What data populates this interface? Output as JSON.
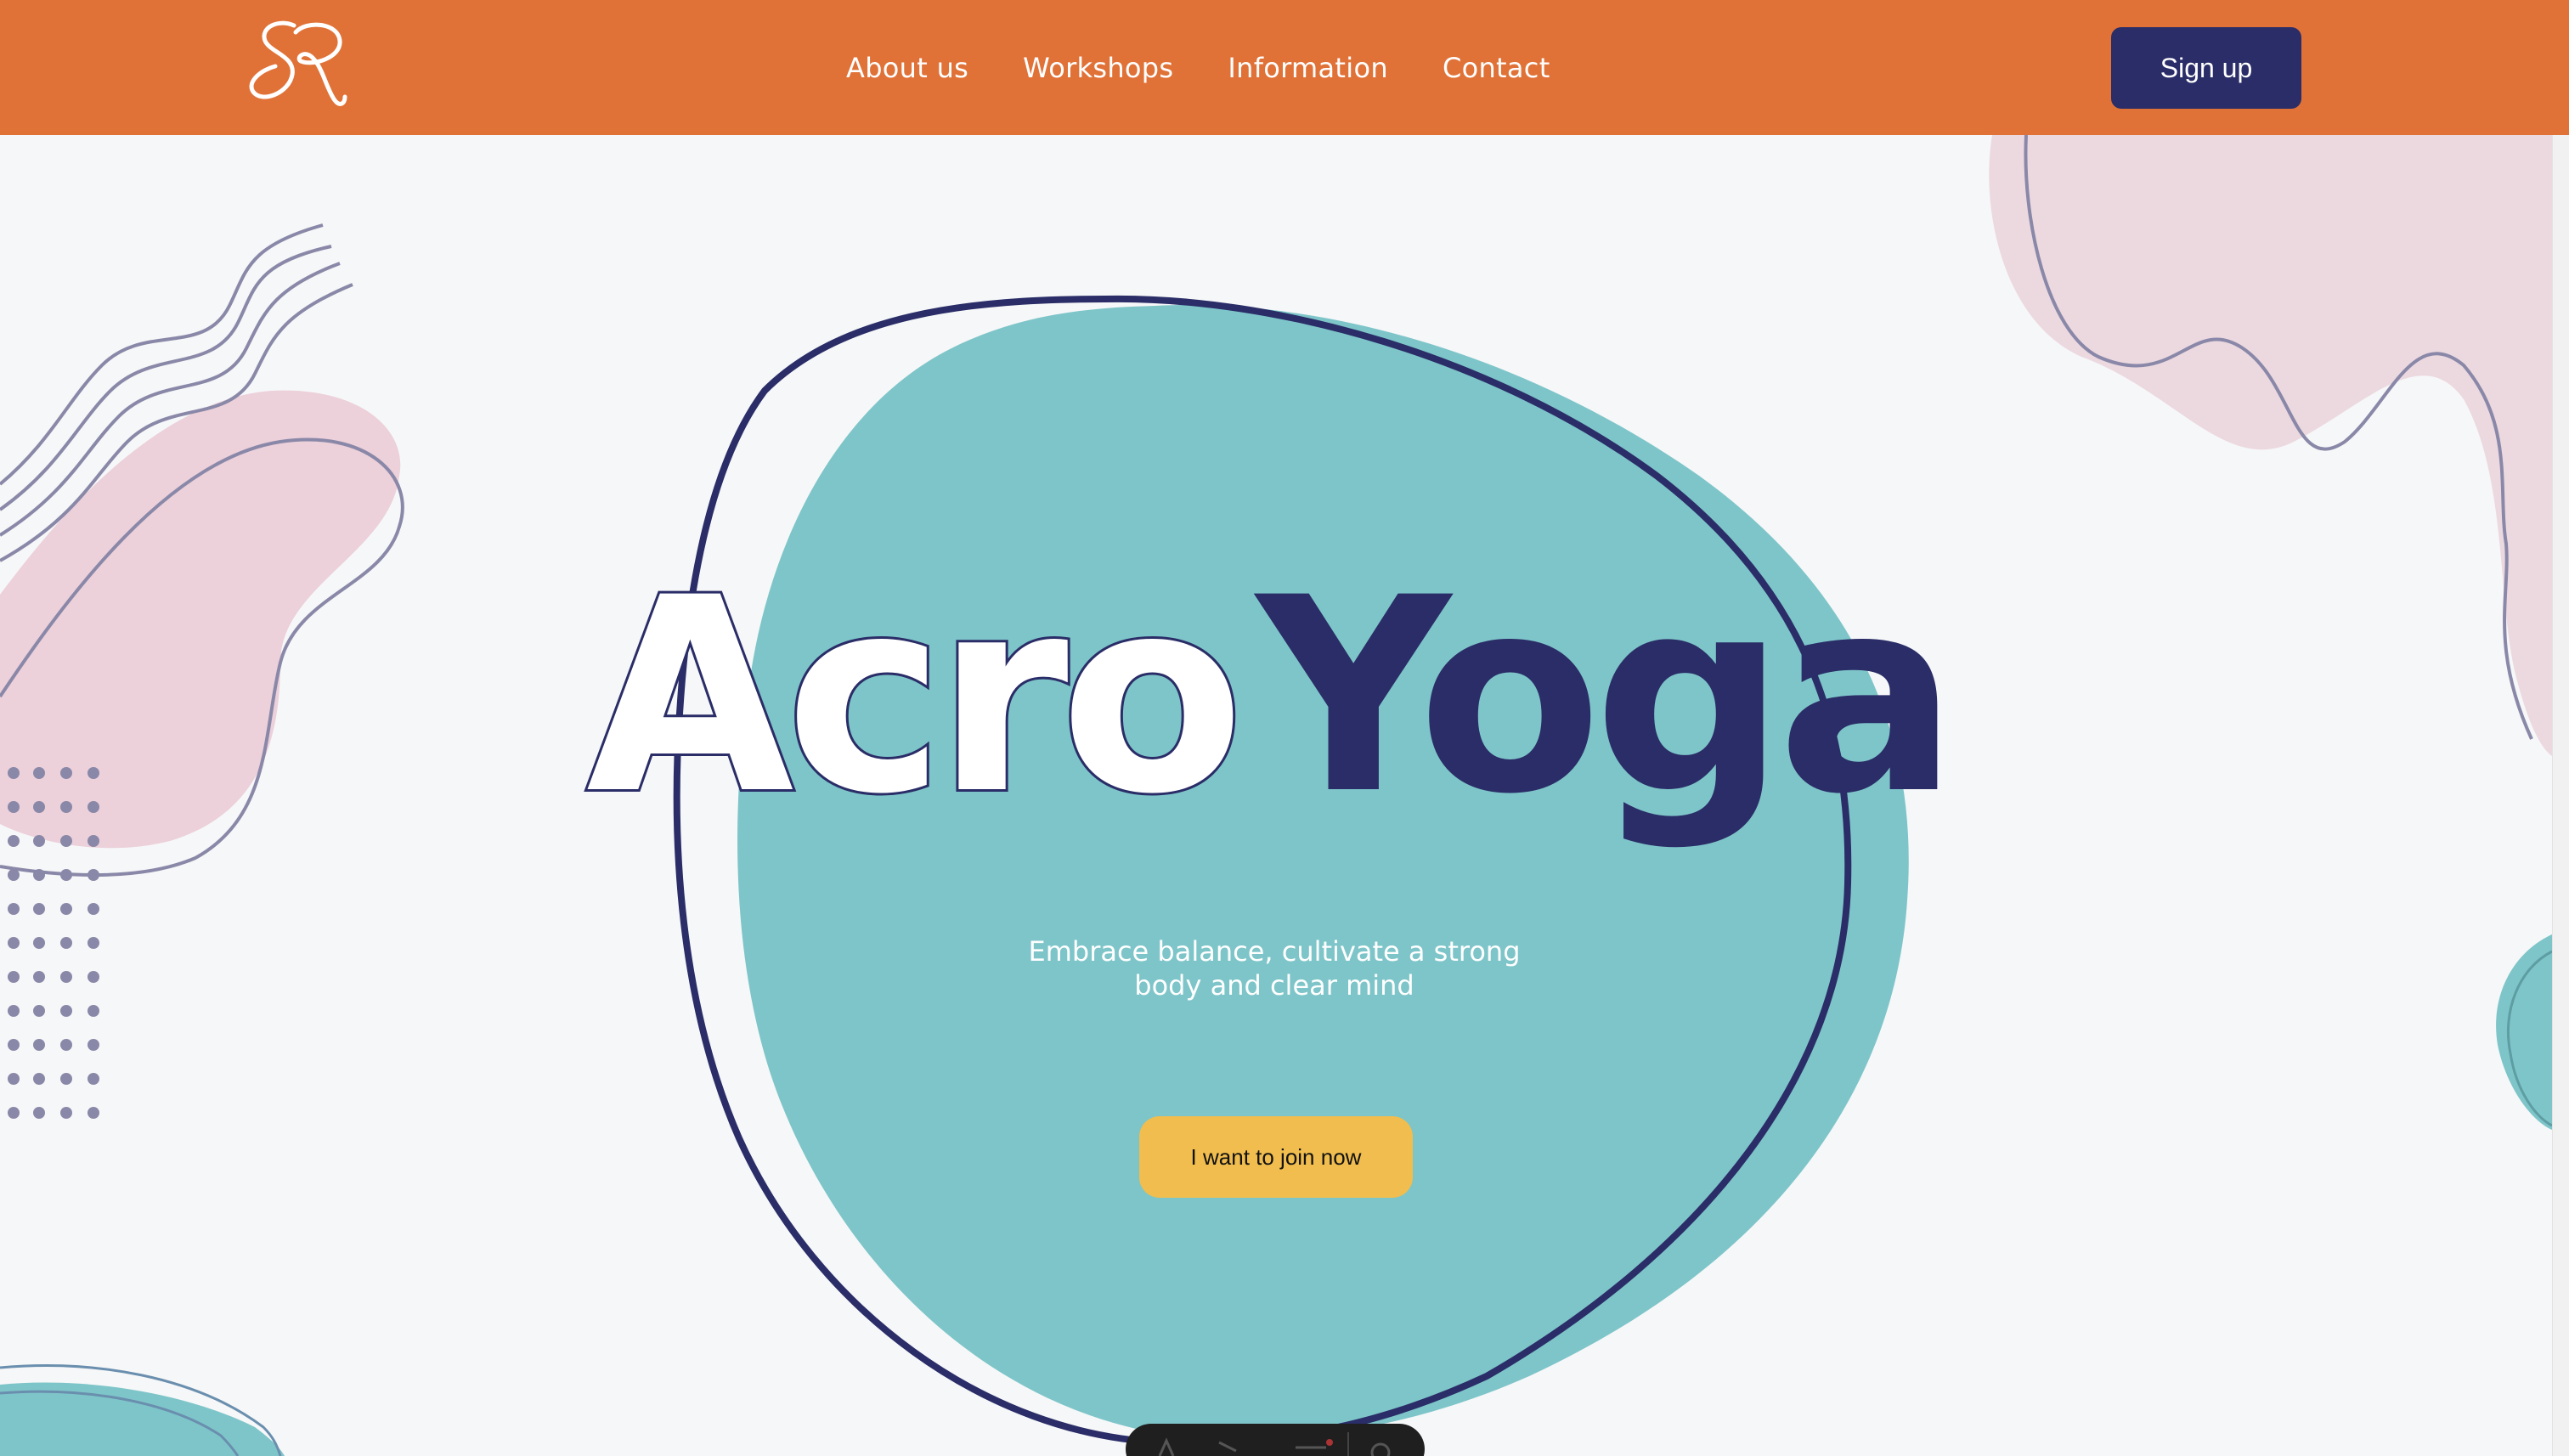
{
  "header": {
    "logo_alt": "SR",
    "nav": [
      {
        "label": "About us"
      },
      {
        "label": "Workshops"
      },
      {
        "label": "Information"
      },
      {
        "label": "Contact"
      }
    ],
    "signup_label": "Sign up"
  },
  "hero": {
    "title_part1": "Acro",
    "title_part2": "Yoga",
    "tagline_line1": "Embrace balance, cultivate a strong",
    "tagline_line2": "body and clear mind",
    "cta_label": "I want to join now"
  },
  "colors": {
    "header_bg": "#e07238",
    "navy": "#2a2d67",
    "teal": "#7ec5c9",
    "pink": "#ecd0da",
    "cta_yellow": "#f0bd4e",
    "page_bg": "#f6f7f8"
  },
  "icons": {
    "logo": "sr-monogram-icon",
    "dock": "toolbar-icons"
  }
}
